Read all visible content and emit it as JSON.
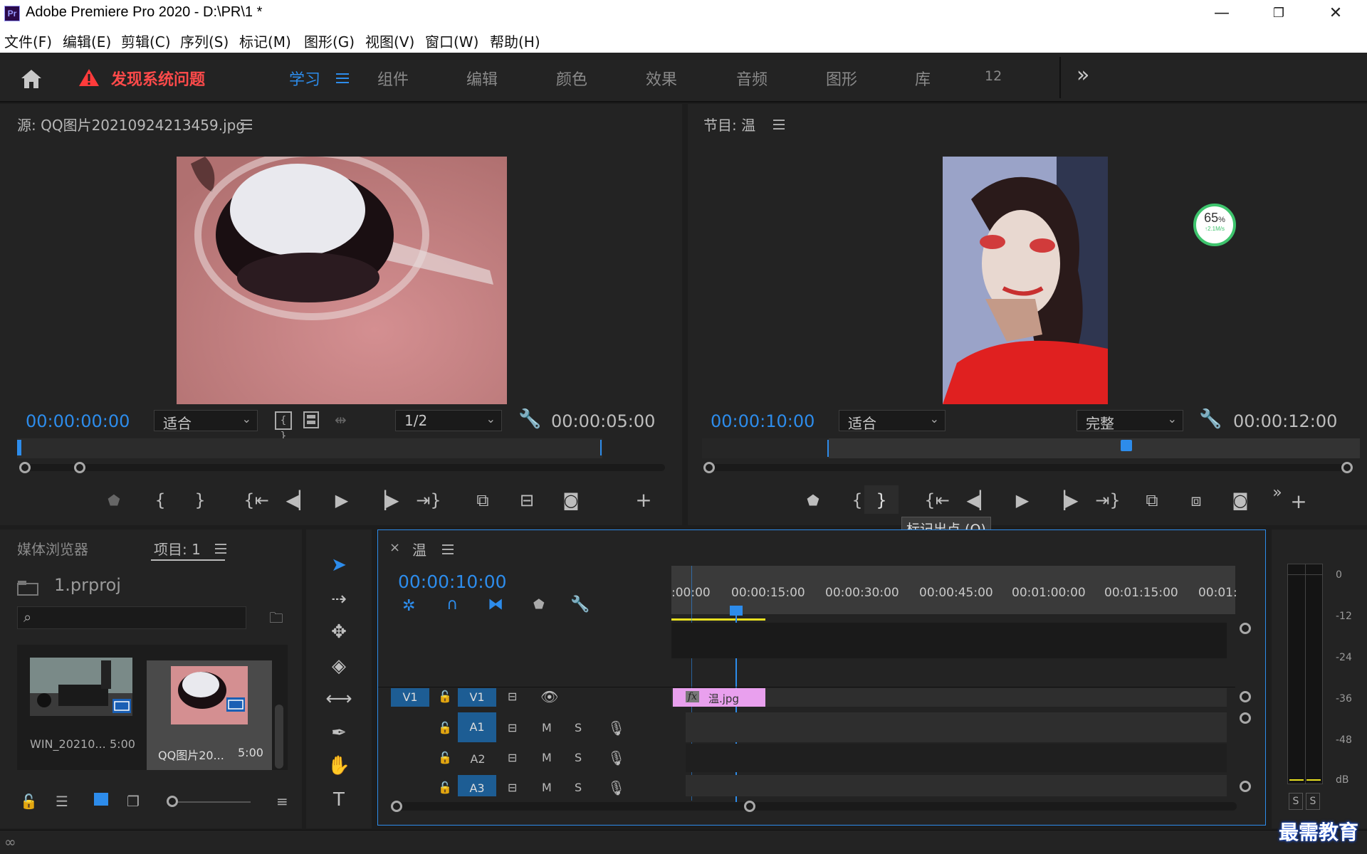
{
  "app": {
    "logo": "Pr",
    "title": "Adobe Premiere Pro 2020 - D:\\PR\\1 *"
  },
  "window_buttons": {
    "minimize": "—",
    "restore": "❐",
    "close": "✕"
  },
  "menu": [
    "文件(F)",
    "编辑(E)",
    "剪辑(C)",
    "序列(S)",
    "标记(M)",
    "图形(G)",
    "视图(V)",
    "窗口(W)",
    "帮助(H)"
  ],
  "workspace": {
    "home_icon": "home-icon",
    "alert": "发现系统问题",
    "tabs": [
      "学习",
      "组件",
      "编辑",
      "颜色",
      "效果",
      "音频",
      "图形",
      "库",
      "12"
    ],
    "active_tab": "学习",
    "more": "»"
  },
  "source_monitor": {
    "title": "源: QQ图片20210924213459.jpg",
    "timecode": "00:00:00:00",
    "fit": "适合",
    "resolution": "1/2",
    "duration": "00:00:05:00"
  },
  "program_monitor": {
    "title": "节目: 温",
    "timecode": "00:00:10:00",
    "fit": "适合",
    "quality": "完整",
    "duration": "00:00:12:00",
    "tooltip": "标记出点 (O)",
    "net_badge_percent": "65",
    "net_badge_unit": "%",
    "net_badge_speed": "↑2.1M/s"
  },
  "project_panel": {
    "tab_media": "媒体浏览器",
    "tab_project": "项目: 1",
    "project_file": "1.prproj",
    "search_placeholder": "",
    "items": [
      {
        "name": "WIN_20210...",
        "duration": "5:00"
      },
      {
        "name": "QQ图片20...",
        "duration": "5:00"
      }
    ]
  },
  "timeline": {
    "close": "×",
    "title": "温",
    "timecode": "00:00:10:00",
    "ruler": [
      ":00:00",
      "00:00:15:00",
      "00:00:30:00",
      "00:00:45:00",
      "00:01:00:00",
      "00:01:15:00",
      "00:01:"
    ],
    "tracks": {
      "v1_source": "V1",
      "v1": "V1",
      "a1": "A1",
      "a2": "A2",
      "a3": "A3",
      "mute": "M",
      "solo": "S"
    },
    "clip": {
      "fx": "fx",
      "name": "温.jpg"
    }
  },
  "audio_meter": {
    "db": [
      "0",
      "-12",
      "-24",
      "-36",
      "-48",
      "dB"
    ],
    "solo_left": "S",
    "solo_right": "S"
  },
  "watermark": "最需教育",
  "colors": {
    "accent": "#2d8ceb",
    "alert": "#ff4a4a",
    "clip": "#e9a0ee"
  }
}
